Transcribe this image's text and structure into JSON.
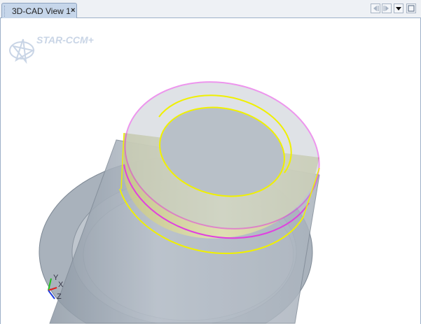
{
  "tab": {
    "label": "3D-CAD View 1",
    "close": "×"
  },
  "toolbar": {
    "icons": [
      "scroll-left-icon",
      "scroll-right-icon",
      "dropdown-icon",
      "maximize-icon"
    ]
  },
  "logo": {
    "text": "STAR-CCM+"
  },
  "triad": {
    "x": "X",
    "y": "Y",
    "z": "Z"
  },
  "colors": {
    "highlight_edge": "#e040e0",
    "selected_face": "#e8e860",
    "body": "#9aa6b2"
  }
}
